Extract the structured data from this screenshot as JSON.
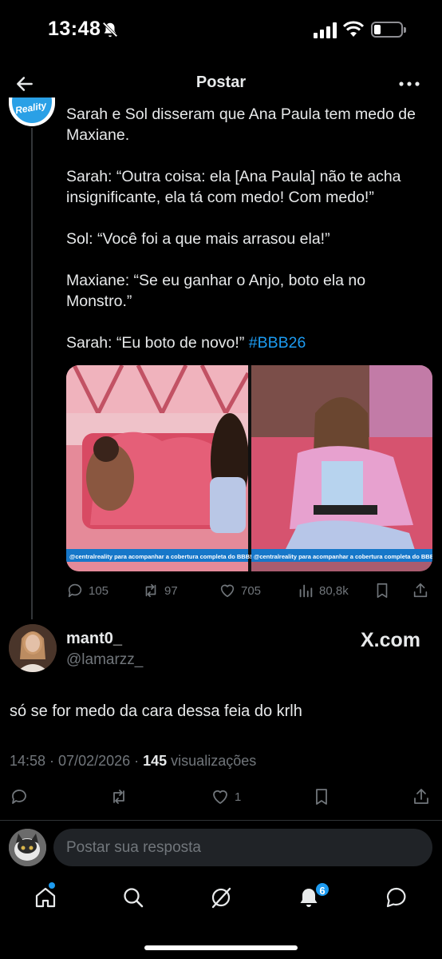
{
  "status_bar": {
    "time": "13:48"
  },
  "header": {
    "title": "Postar"
  },
  "parent_post": {
    "text": "Sarah e Sol disseram que Ana Paula tem medo de Maxiane.\n\nSarah: “Outra coisa: ela [Ana Paula] não te acha insignificante, ela tá com medo! Com medo!”\n\nSol: “Você foi a que mais arrasou ela!”\n\nMaxiane: “Se eu ganhar o Anjo, boto ela no Monstro.”\n\nSarah: “Eu boto de novo!” ",
    "hashtag": "#BBB26",
    "avatar_label": "Reality",
    "media_caption_left": "@centralreality para acompanhar a cobertura completa do BBB!",
    "media_caption_right": "@centralreality para acompanhar a cobertura completa do BBB!",
    "replies": "105",
    "reposts": "97",
    "likes": "705",
    "views": "80,8k"
  },
  "reply": {
    "name": "mant0_",
    "handle": "@lamarzz_",
    "source_logo": "X.com",
    "text": "só se for medo da cara dessa feia do krlh",
    "time_date": "14:58 · 07/02/2026 · ",
    "views_count": "145",
    "views_label": " visualizações",
    "likes": "1"
  },
  "compose": {
    "placeholder": "Postar sua resposta"
  },
  "tabbar": {
    "notifications_badge": "6"
  },
  "colors": {
    "accent": "#1d9bf0",
    "background": "#000000",
    "muted": "#71767b"
  }
}
